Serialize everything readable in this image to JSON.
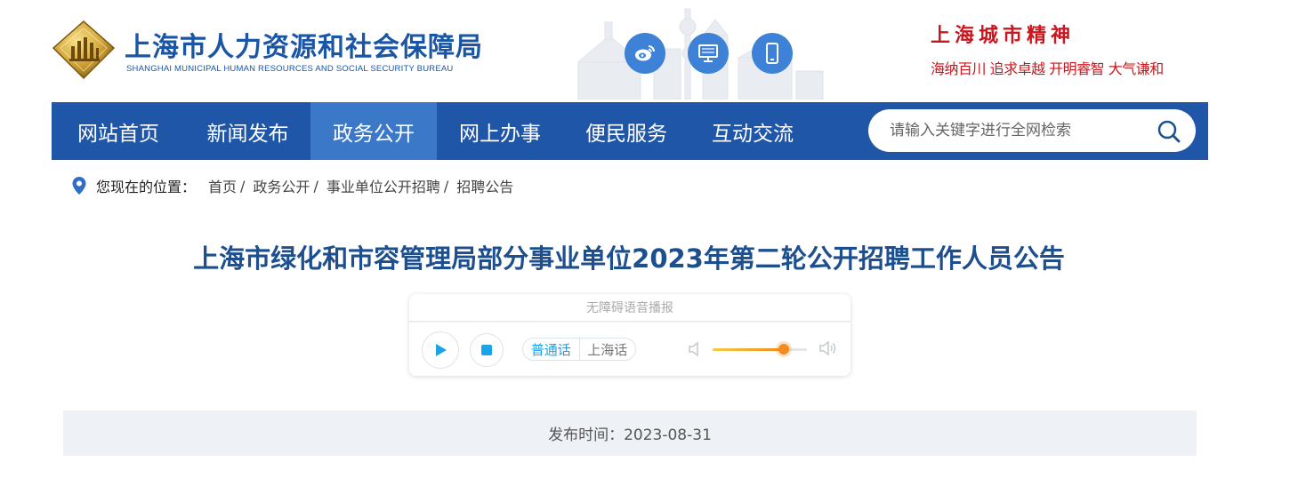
{
  "header": {
    "org_name_cn": "上海市人力资源和社会保障局",
    "org_name_en": "SHANGHAI MUNICIPAL HUMAN RESOURCES AND SOCIAL SECURITY BUREAU",
    "social_icons": [
      "weibo-icon",
      "desktop-icon",
      "mobile-icon"
    ],
    "spirit_title": "上海城市精神",
    "spirit_motto": "海纳百川  追求卓越  开明睿智  大气谦和"
  },
  "nav": {
    "items": [
      {
        "label": "网站首页",
        "active": false
      },
      {
        "label": "新闻发布",
        "active": false
      },
      {
        "label": "政务公开",
        "active": true
      },
      {
        "label": "网上办事",
        "active": false
      },
      {
        "label": "便民服务",
        "active": false
      },
      {
        "label": "互动交流",
        "active": false
      }
    ],
    "search_placeholder": "请输入关键字进行全网检索"
  },
  "breadcrumb": {
    "label": "您现在的位置：",
    "items": [
      "首页",
      "政务公开",
      "事业单位公开招聘",
      "招聘公告"
    ],
    "separator": "/"
  },
  "article": {
    "title": "上海市绿化和市容管理局部分事业单位2023年第二轮公开招聘工作人员公告",
    "publish_label": "发布时间：2023-08-31"
  },
  "player": {
    "header": "无障碍语音播报",
    "lang_a": "普通话",
    "lang_b": "上海话",
    "volume": 0.75
  },
  "colors": {
    "nav_bg": "#2056a8",
    "nav_active": "#3b78c8",
    "title": "#1d4f8f",
    "spirit": "#c8171e"
  }
}
